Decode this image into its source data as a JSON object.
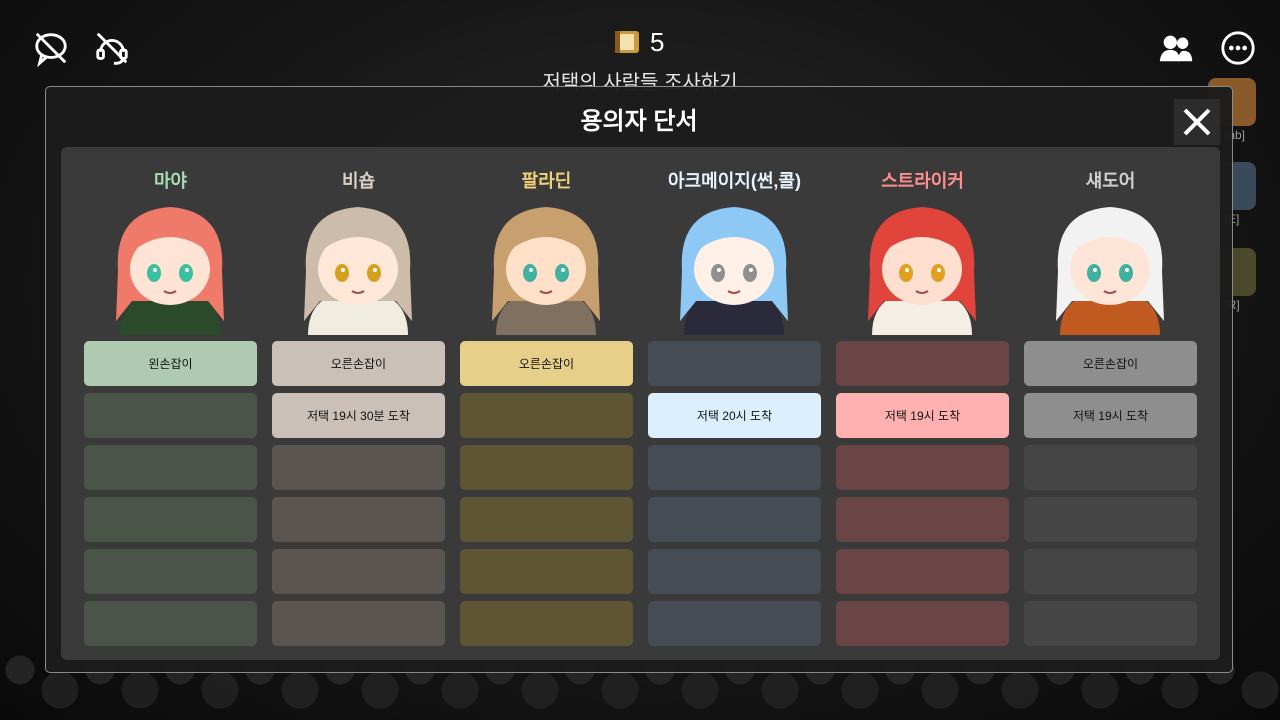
{
  "hud": {
    "counter_value": "5",
    "quest_title": "저택의 사람들 조사하기",
    "shortcuts": [
      {
        "label": "[Tab]"
      },
      {
        "label": "[E]"
      },
      {
        "label": "[R]"
      }
    ]
  },
  "panel": {
    "title": "용의자 단서"
  },
  "suspects": [
    {
      "name": "마야",
      "name_color": "#a9dcb5",
      "cell_active": "#aecbb1",
      "cell_empty": "#4a5448",
      "clues": [
        "왼손잡이",
        "",
        "",
        "",
        "",
        ""
      ]
    },
    {
      "name": "비숍",
      "name_color": "#d8d0c8",
      "cell_active": "#cbc0b8",
      "cell_empty": "#5a5550",
      "clues": [
        "오른손잡이",
        "저택 19시 30분 도착",
        "",
        "",
        "",
        ""
      ]
    },
    {
      "name": "팔라딘",
      "name_color": "#f1d27a",
      "cell_active": "#e6cf88",
      "cell_empty": "#5e5535",
      "clues": [
        "오른손잡이",
        "",
        "",
        "",
        "",
        ""
      ]
    },
    {
      "name": "아크메이지(썬,콜)",
      "name_color": "#e8f3ff",
      "cell_active": "#dcefff",
      "cell_empty": "#454c55",
      "clues": [
        "",
        "저택 20시 도착",
        "",
        "",
        "",
        ""
      ]
    },
    {
      "name": "스트라이커",
      "name_color": "#ff8f8f",
      "cell_active": "#ffb0b0",
      "cell_empty": "#6a4545",
      "clues": [
        "",
        "저택 19시 도착",
        "",
        "",
        "",
        ""
      ]
    },
    {
      "name": "섀도어",
      "name_color": "#cfcfcf",
      "cell_active": "#8e8e8e",
      "cell_empty": "#454545",
      "clues": [
        "오른손잡이",
        "저택 19시 도착",
        "",
        "",
        "",
        ""
      ]
    }
  ]
}
